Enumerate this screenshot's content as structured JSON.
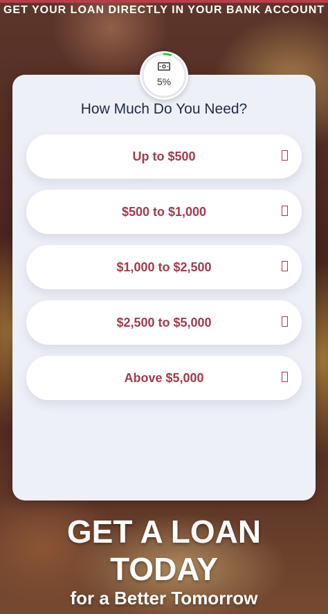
{
  "header": {
    "headline": "GET YOUR LOAN DIRECTLY IN YOUR BANK ACCOUNT"
  },
  "progress": {
    "percent_label": "5%",
    "value": 0.05,
    "icon": "money-bill-icon",
    "ring_color": "#2ecc40"
  },
  "form": {
    "question": "How Much Do You Need?",
    "options": [
      {
        "label": "Up to $500"
      },
      {
        "label": "$500 to $1,000"
      },
      {
        "label": "$1,000 to $2,500"
      },
      {
        "label": "$2,500 to $5,000"
      },
      {
        "label": "Above $5,000"
      }
    ]
  },
  "hero": {
    "line1": "GET A LOAN",
    "line2": "TODAY",
    "tagline": "for a Better Tomorrow"
  },
  "colors": {
    "accent": "#a13a4e",
    "heading": "#1f2a4a",
    "card": "#eef0f8"
  }
}
